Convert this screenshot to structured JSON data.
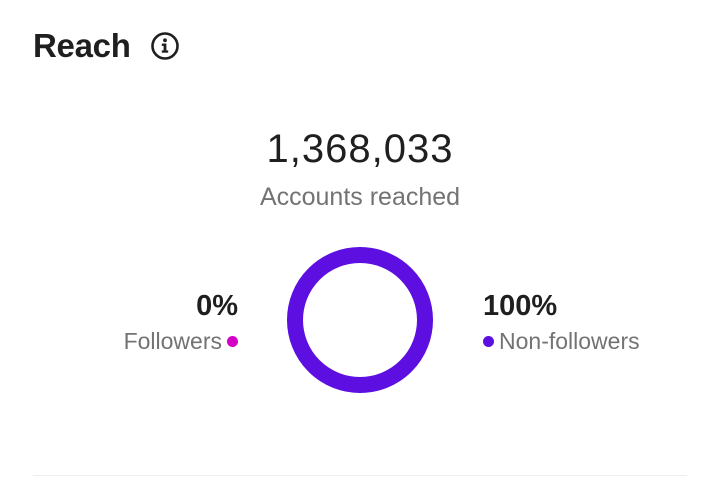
{
  "header": {
    "title": "Reach",
    "info_icon": "info-circle-icon"
  },
  "summary": {
    "total": "1,368,033",
    "label": "Accounts reached"
  },
  "breakdown": {
    "followers": {
      "percent_text": "0%",
      "label": "Followers",
      "value": 0,
      "color": "#d300c5"
    },
    "non_followers": {
      "percent_text": "100%",
      "label": "Non-followers",
      "value": 100,
      "color": "#5c0fe0"
    }
  },
  "colors": {
    "text_primary": "#1f1f1f",
    "text_secondary": "#737373",
    "divider": "#efefef"
  }
}
